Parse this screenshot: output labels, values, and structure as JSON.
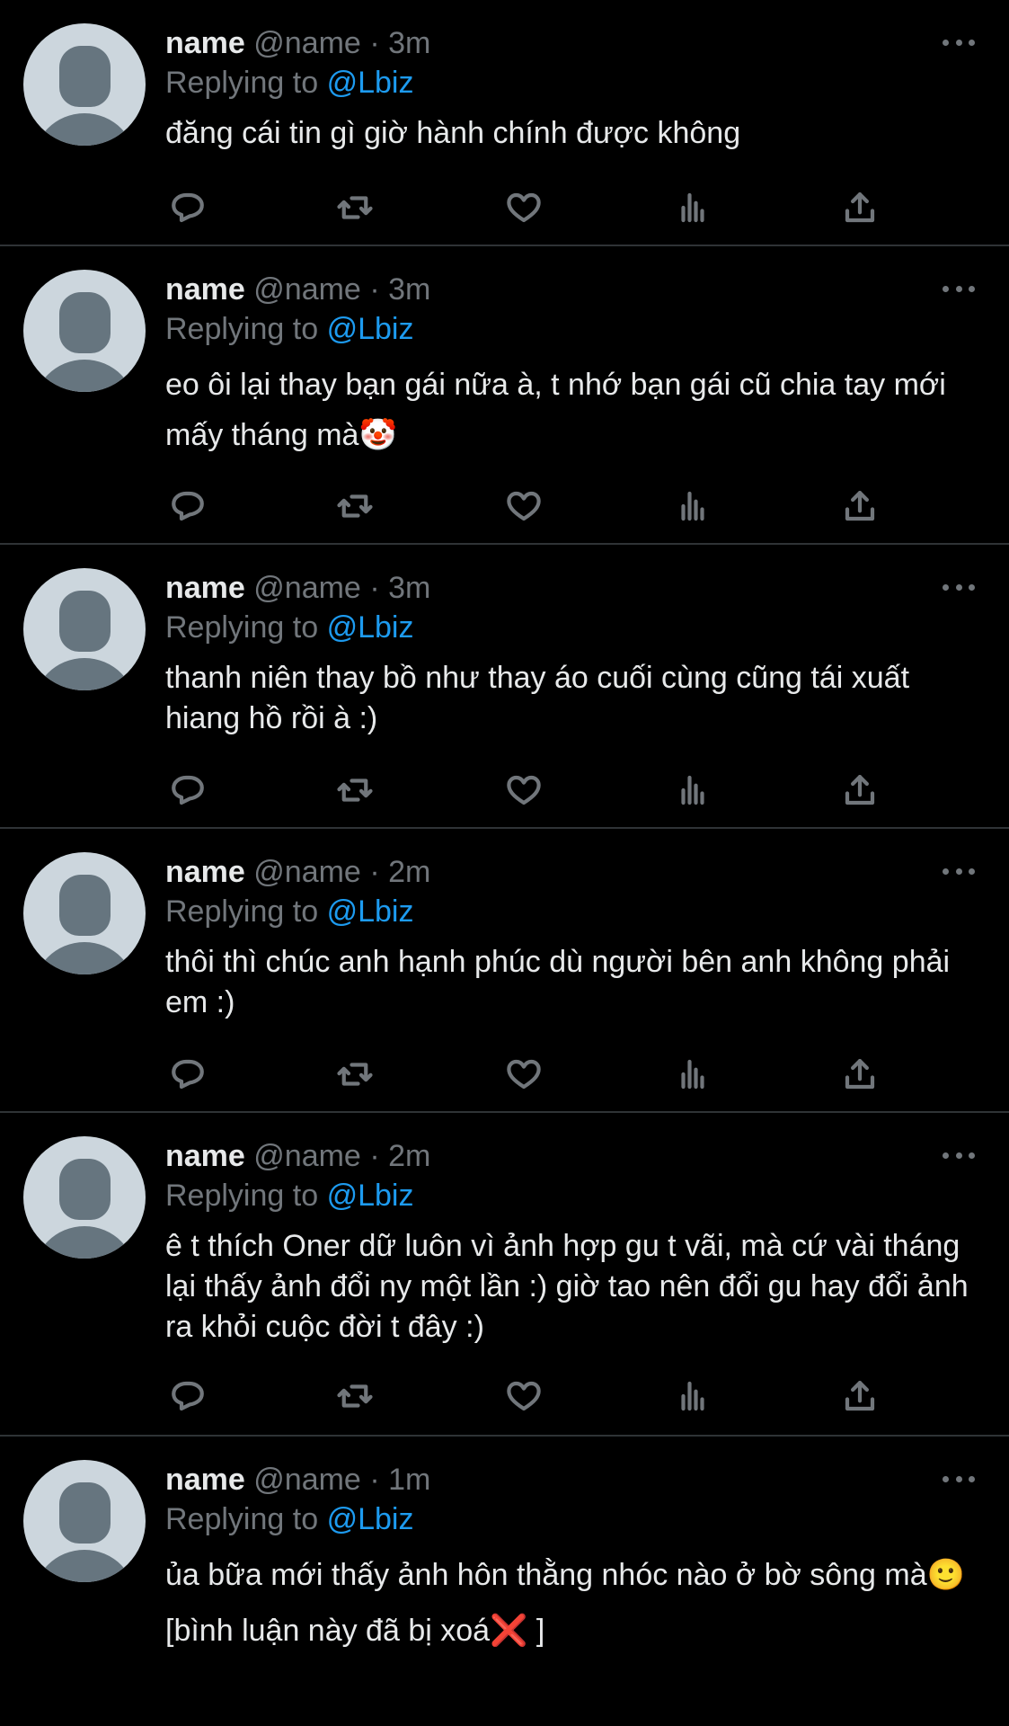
{
  "tweets": [
    {
      "username": "name",
      "handle": "@name",
      "separator": "·",
      "time": "3m",
      "reply_prefix": "Replying to",
      "reply_to": "@Lbiz",
      "lines": [
        "đăng cái tin gì giờ hành chính được không"
      ]
    },
    {
      "username": "name",
      "handle": "@name",
      "separator": "·",
      "time": "3m",
      "reply_prefix": "Replying to",
      "reply_to": "@Lbiz",
      "lines": [
        "eo ôi lại thay bạn gái nữa à, t nhớ bạn gái cũ chia tay mới mấy tháng mà🤡"
      ]
    },
    {
      "username": "name",
      "handle": "@name",
      "separator": "·",
      "time": "3m",
      "reply_prefix": "Replying to",
      "reply_to": "@Lbiz",
      "lines": [
        "thanh niên thay bồ như thay áo cuối cùng cũng tái xuất hiang hồ rồi à :)"
      ]
    },
    {
      "username": "name",
      "handle": "@name",
      "separator": "·",
      "time": "2m",
      "reply_prefix": "Replying to",
      "reply_to": "@Lbiz",
      "lines": [
        "thôi thì chúc anh hạnh phúc dù người bên anh không phải em :)"
      ]
    },
    {
      "username": "name",
      "handle": "@name",
      "separator": "·",
      "time": "2m",
      "reply_prefix": "Replying to",
      "reply_to": "@Lbiz",
      "lines": [
        "ê t thích Oner dữ luôn vì ảnh hợp gu t vãi, mà cứ vài tháng lại thấy ảnh đổi ny một lần :) giờ tao nên đổi gu hay đổi ảnh ra khỏi cuộc đời t đây :)"
      ]
    },
    {
      "username": "name",
      "handle": "@name",
      "separator": "·",
      "time": "1m",
      "reply_prefix": "Replying to",
      "reply_to": "@Lbiz",
      "lines": [
        "ủa bữa mới thấy ảnh hôn thằng nhóc nào ở bờ sông mà🙂",
        "[bình luận này đã bị xoá❌ ]"
      ]
    }
  ],
  "icons": {
    "reply": "reply-icon",
    "retweet": "retweet-icon",
    "like": "like-icon",
    "views": "views-icon",
    "share": "share-icon",
    "more": "more-icon"
  },
  "colors": {
    "background": "#000000",
    "text": "#e7e9ea",
    "muted": "#71767b",
    "link": "#1d9bf0",
    "divider": "#2f3336"
  }
}
